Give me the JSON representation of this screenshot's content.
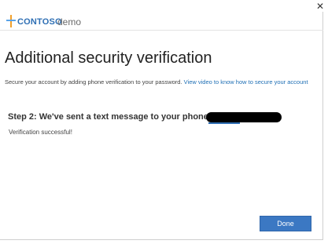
{
  "window": {
    "close_glyph": "✕"
  },
  "header": {
    "brand": "CONTOSO",
    "brand_sub": "demo",
    "logo_icon": "contoso-cross-icon",
    "brand_color": "#2e6fb4",
    "logo_colors": [
      "#f2a02a",
      "#5aa3e8"
    ]
  },
  "main": {
    "title": "Additional security verification",
    "intro_text": "Secure your account by adding phone verification to your password.",
    "intro_link": "View video to know how to secure your account",
    "step_text": "Step 2: We've sent a text message to your phone at",
    "status_text": "Verification successful!"
  },
  "footer": {
    "done_label": "Done",
    "done_color": "#3b78c3"
  }
}
